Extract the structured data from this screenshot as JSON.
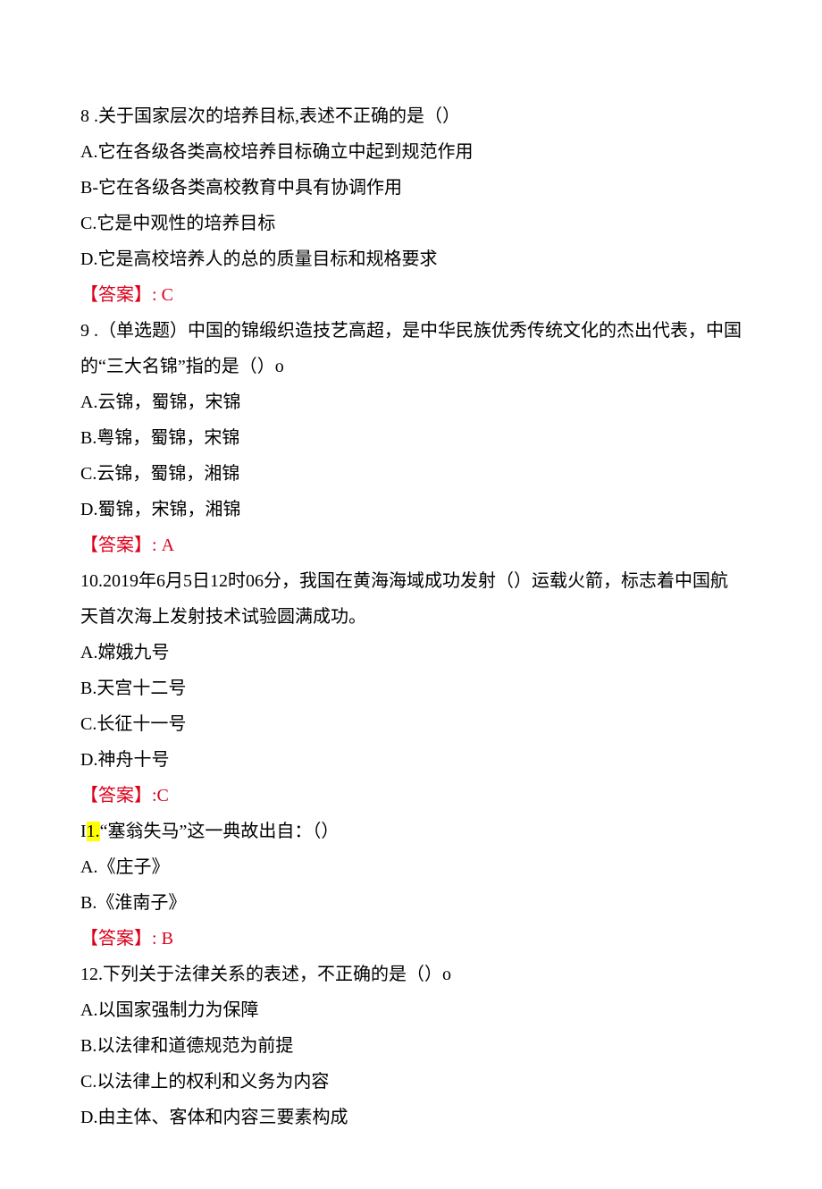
{
  "q8": {
    "stem": "8 .关于国家层次的培养目标,表述不正确的是（）",
    "A": "A.它在各级各类高校培养目标确立中起到规范作用",
    "B": "B-它在各级各类高校教育中具有协调作用",
    "C": "C.它是中观性的培养目标",
    "D": "D.它是高校培养人的总的质量目标和规格要求",
    "ans_label": "【答案】:",
    "ans_value": " C"
  },
  "q9": {
    "stem": "9 .（单选题）中国的锦缎织造技艺高超，是中华民族优秀传统文化的杰出代表，中国的“三大名锦”指的是（）o",
    "A": "A.云锦，蜀锦，宋锦",
    "B": "B.粤锦，蜀锦，宋锦",
    "C": "C.云锦，蜀锦，湘锦",
    "D": "D.蜀锦，宋锦，湘锦",
    "ans_label": "【答案】:",
    "ans_value": " A"
  },
  "q10": {
    "stem": "10.2019年6月5日12时06分，我国在黄海海域成功发射（）运载火箭，标志着中国航天首次海上发射技术试验圆满成功。",
    "A": "A.嫦娥九号",
    "B": "B.天宫十二号",
    "C": "C.长征十一号",
    "D": "D.神舟十号",
    "ans_full": "【答案】:C"
  },
  "q11": {
    "prefix": "I",
    "hl": "1.",
    "rest": "“塞翁失马”这一典故出自：（）",
    "A": "A.《庄子》",
    "B": "B.《淮南子》",
    "ans_label": "【答案】:",
    "ans_value": " B"
  },
  "q12": {
    "stem": "12.下列关于法律关系的表述，不正确的是（）o",
    "A": "A.以国家强制力为保障",
    "B": "B.以法律和道德规范为前提",
    "C": "C.以法律上的权利和义务为内容",
    "D": "D.由主体、客体和内容三要素构成"
  }
}
